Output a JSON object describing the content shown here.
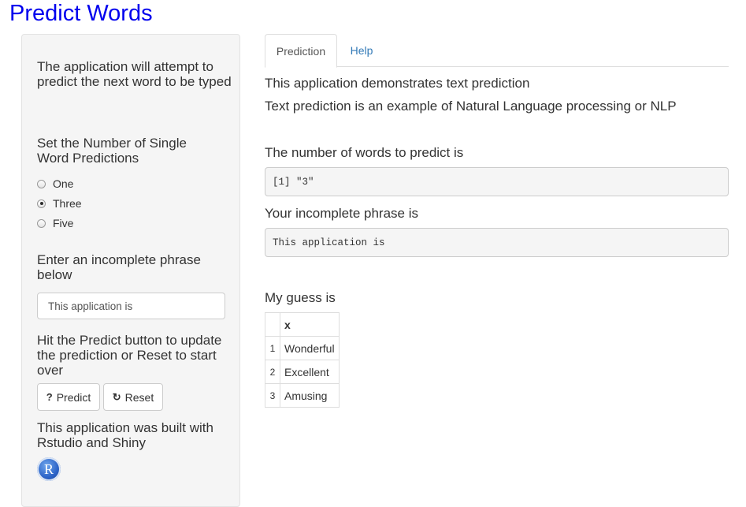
{
  "app": {
    "title": "Predict Words"
  },
  "sidebar": {
    "intro": "The application will attempt to predict the next word to be typed",
    "radio_label": "Set the Number of Single Word Predictions",
    "radio_options": [
      {
        "label": "One",
        "checked": false
      },
      {
        "label": "Three",
        "checked": true
      },
      {
        "label": "Five",
        "checked": false
      }
    ],
    "input_label": "Enter an incomplete phrase below",
    "input_value": "This application is",
    "instructions": "Hit the Predict button to update the prediction or Reset to start over",
    "predict_button": "Predict",
    "reset_button": "Reset",
    "built_with": "This application was built with Rstudio and Shiny",
    "logo_letter": "R"
  },
  "tabs": [
    {
      "label": "Prediction",
      "active": true
    },
    {
      "label": "Help",
      "active": false
    }
  ],
  "main": {
    "line1": "This application demonstrates text prediction",
    "line2": "Text prediction is an example of Natural Language processing or NLP",
    "num_words_label": "The number of words to predict is",
    "num_words_output": "[1] \"3\"",
    "phrase_label": "Your incomplete phrase is",
    "phrase_output": "This application is",
    "guess_label": "My guess is",
    "table": {
      "header": "x",
      "rows": [
        {
          "idx": "1",
          "word": "Wonderful"
        },
        {
          "idx": "2",
          "word": "Excellent"
        },
        {
          "idx": "3",
          "word": "Amusing"
        }
      ]
    }
  },
  "colors": {
    "title": "#0000ee",
    "link": "#337ab7",
    "well": "#f5f5f5"
  }
}
